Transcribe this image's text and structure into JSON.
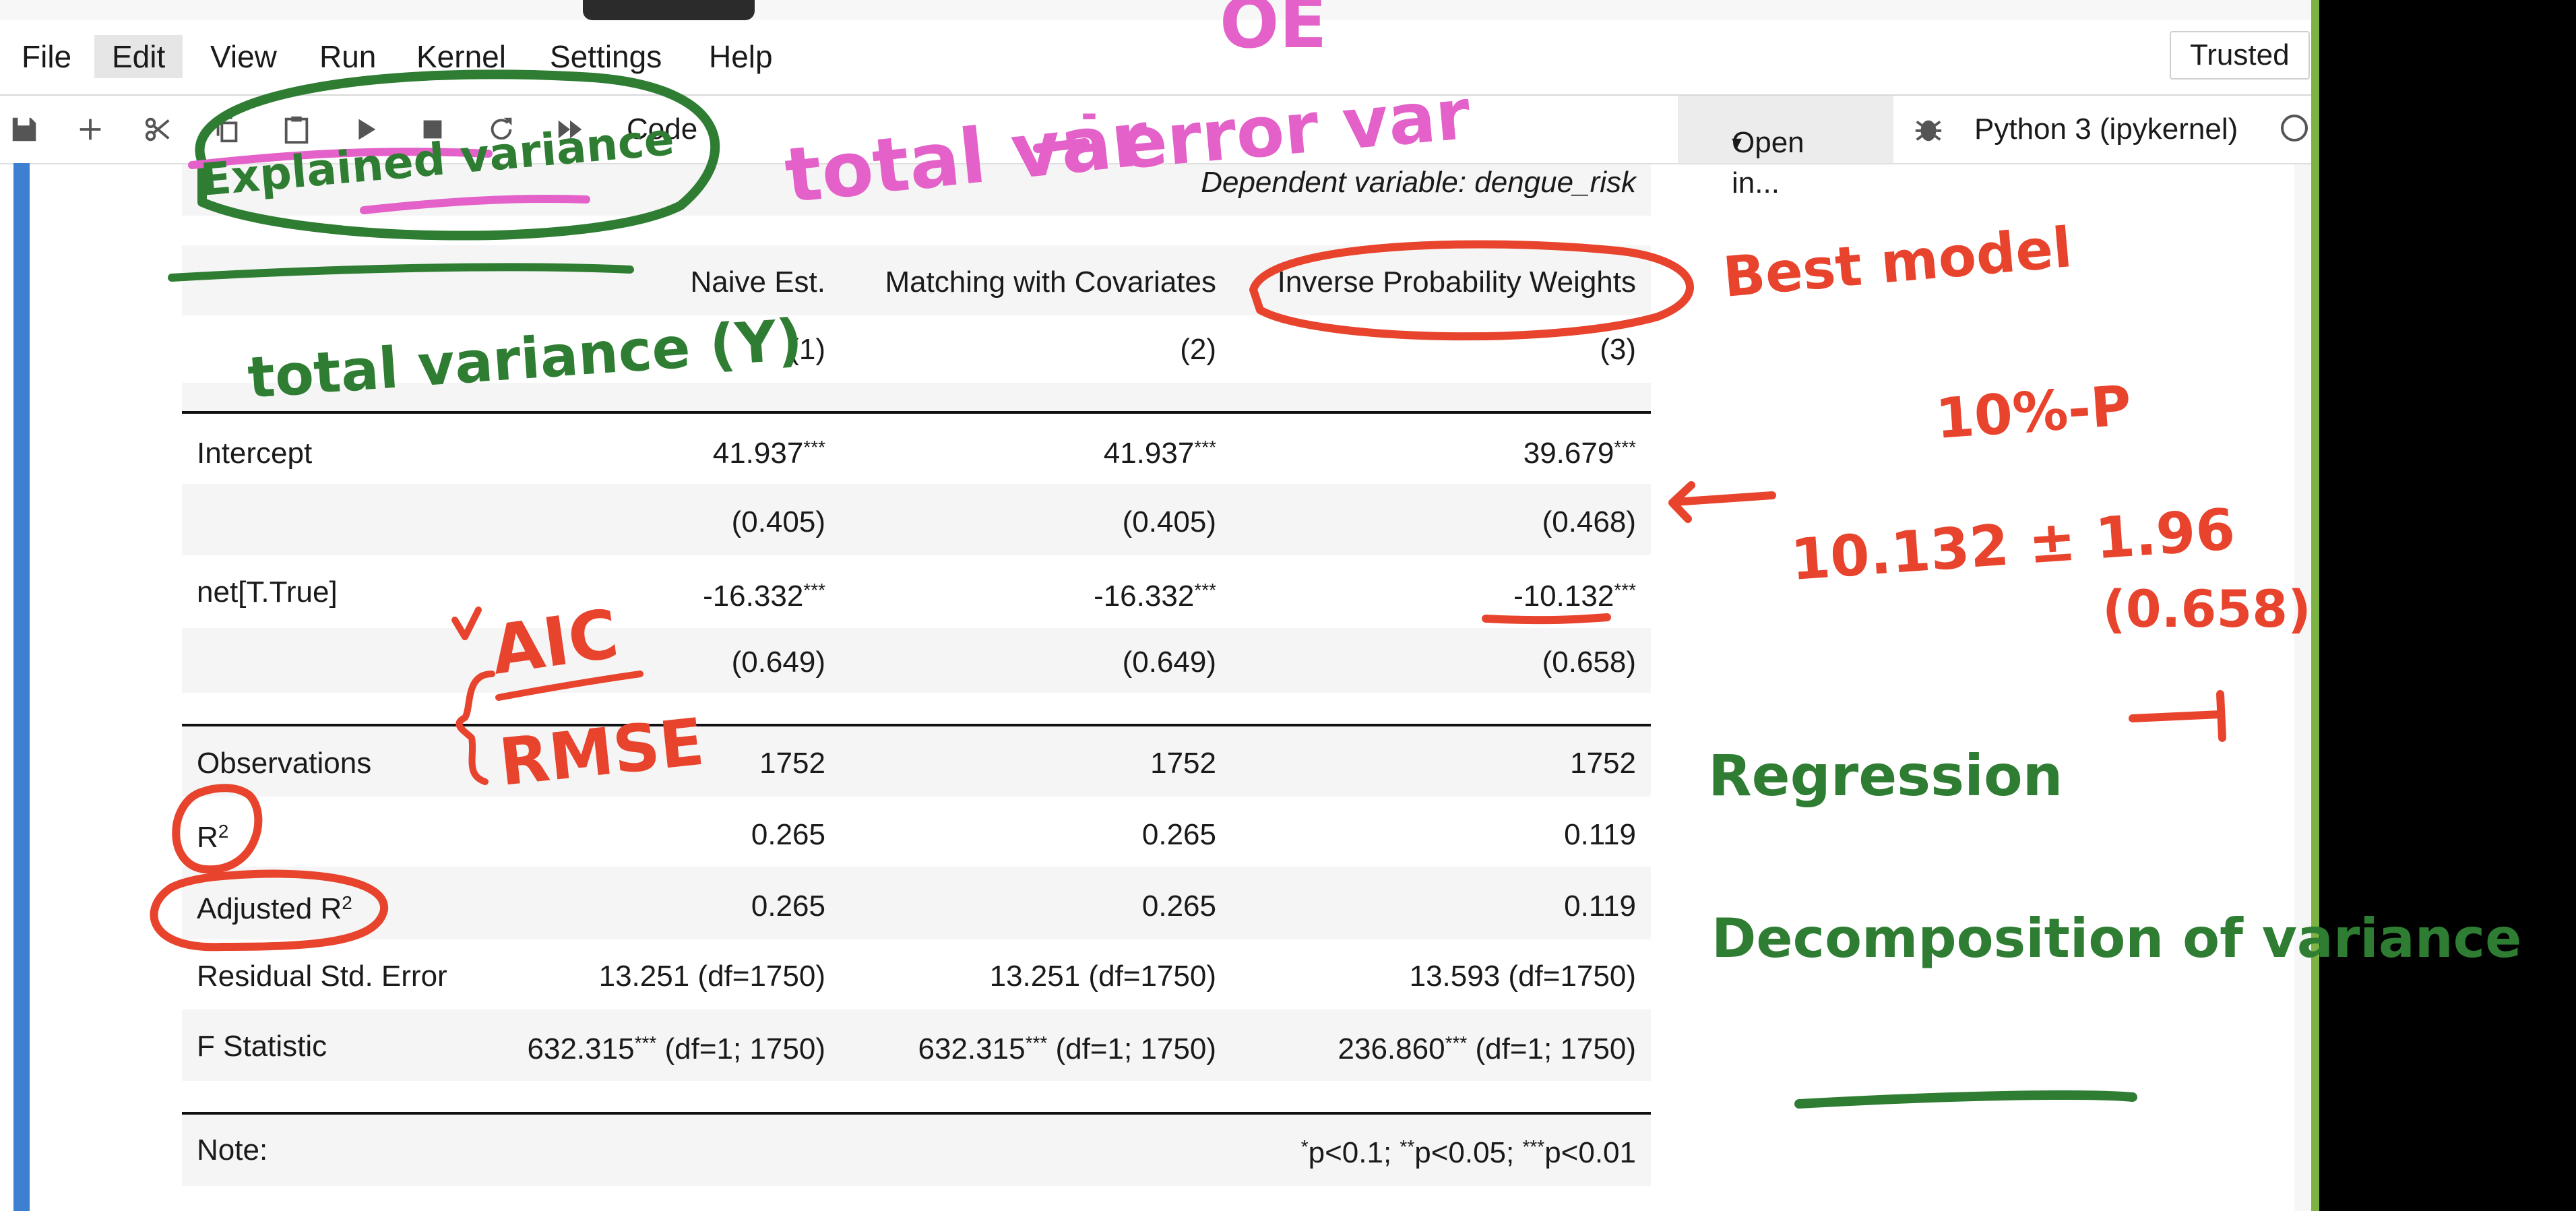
{
  "menu": {
    "items": [
      "File",
      "Edit",
      "View",
      "Run",
      "Kernel",
      "Settings",
      "Help"
    ],
    "active": "Edit",
    "trusted": "Trusted"
  },
  "toolbar": {
    "icons": [
      "save-icon",
      "add-icon",
      "cut-icon",
      "copy-icon",
      "paste-icon",
      "run-icon",
      "stop-icon",
      "restart-icon",
      "fast-forward-icon"
    ],
    "cell_type": "Code",
    "open_in": "Open in...",
    "kernel": "Python 3 (ipykernel)"
  },
  "table": {
    "dep_var": "Dependent variable: dengue_risk",
    "headers": [
      "Naive Est.",
      "Matching with Covariates",
      "Inverse Probability Weights"
    ],
    "col_numbers": [
      "(1)",
      "(2)",
      "(3)"
    ],
    "intercept": {
      "label": "Intercept",
      "values": [
        "41.937",
        "41.937",
        "39.679"
      ],
      "stars": "***",
      "se": [
        "(0.405)",
        "(0.405)",
        "(0.468)"
      ]
    },
    "net": {
      "label": "net[T.True]",
      "values": [
        "-16.332",
        "-16.332",
        "-10.132"
      ],
      "stars": "***",
      "se": [
        "(0.649)",
        "(0.649)",
        "(0.658)"
      ]
    },
    "observations": {
      "label": "Observations",
      "values": [
        "1752",
        "1752",
        "1752"
      ]
    },
    "r2": {
      "label": "R",
      "sup": "2",
      "values": [
        "0.265",
        "0.265",
        "0.119"
      ]
    },
    "adj_r2": {
      "label": "Adjusted R",
      "sup": "2",
      "values": [
        "0.265",
        "0.265",
        "0.119"
      ]
    },
    "rse": {
      "label": "Residual Std. Error",
      "values": [
        "13.251 (df=1750)",
        "13.251 (df=1750)",
        "13.593 (df=1750)"
      ]
    },
    "fstat": {
      "label": "F Statistic",
      "values": [
        "632.315",
        "632.315",
        "236.860"
      ],
      "stars": "***",
      "df": [
        " (df=1; 1750)",
        " (df=1; 1750)",
        " (df=1; 1750)"
      ]
    },
    "note": {
      "label": "Note:",
      "s1": "*",
      "p1": "p<0.1; ",
      "s2": "**",
      "p2": "p<0.05; ",
      "s3": "***",
      "p3": "p<0.01"
    }
  },
  "annotations": {
    "pink_total_var": "total var",
    "pink_minus": "-",
    "pink_error_var": "error var",
    "pink_oe": "OE",
    "green_explained": "Explained variance",
    "green_total_variance": "total variance (Y)",
    "red_best_model": "Best model",
    "red_10p": "10%-P",
    "red_ci": "10.132 ± 1.96",
    "red_se": "(0.658)",
    "red_aic": "AIC",
    "red_rmse": "RMSE",
    "green_regression": "Regression",
    "green_decomp": "Decomposition of variance"
  },
  "colors": {
    "ink_red": "#e8432c",
    "ink_green": "#2e7d32",
    "ink_pink": "#e361c8",
    "cell_bar": "#3d7fd0"
  }
}
